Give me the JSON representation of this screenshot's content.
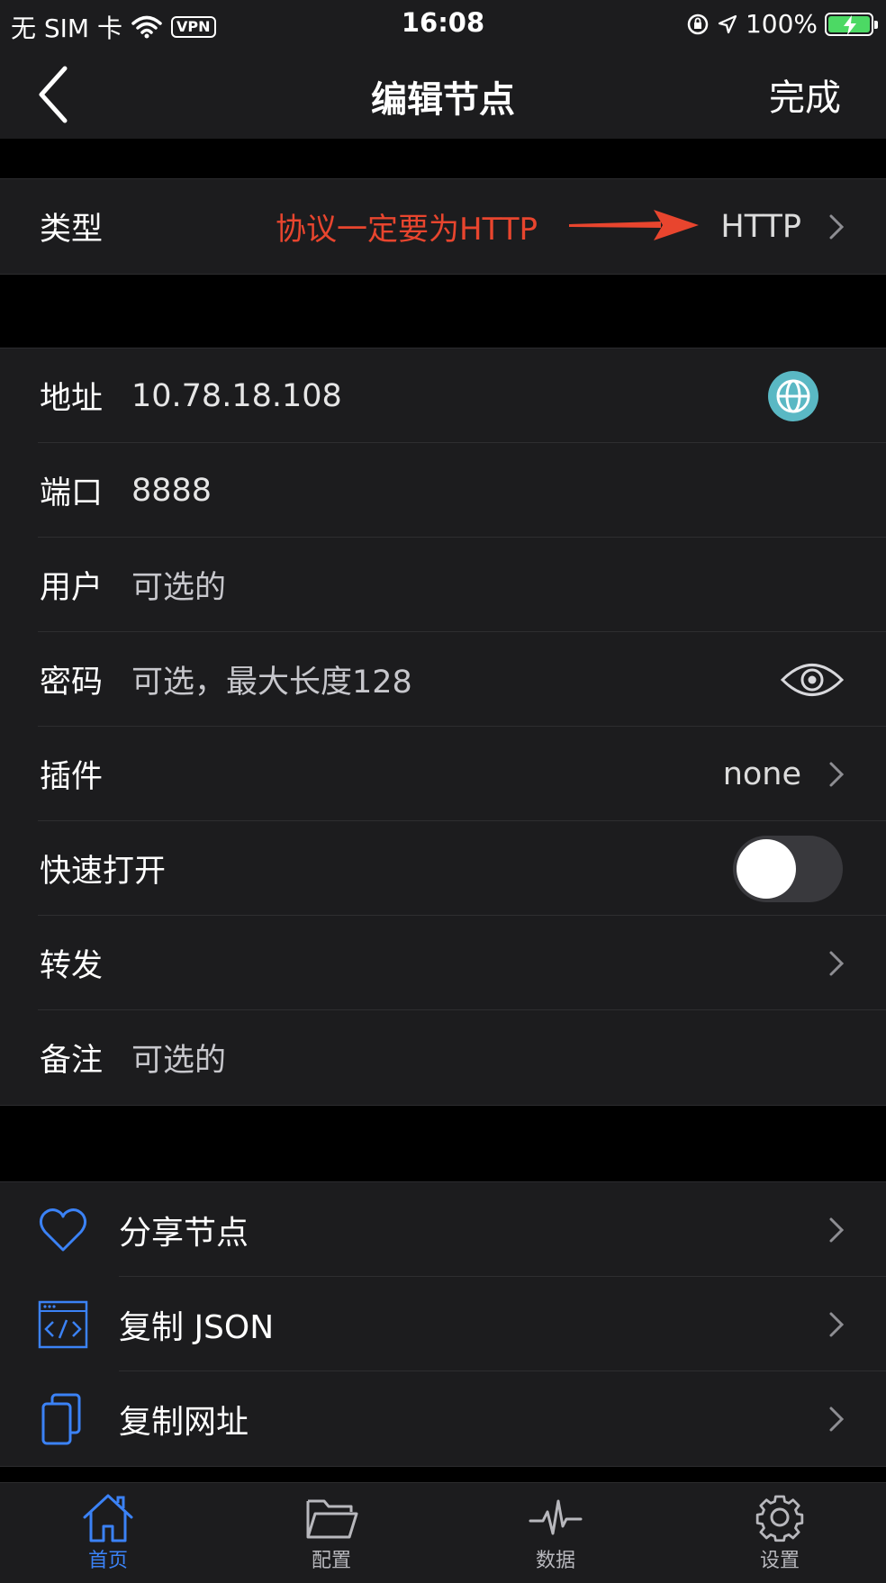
{
  "status_bar": {
    "carrier": "无 SIM 卡",
    "vpn": "VPN",
    "time": "16:08",
    "battery": "100%"
  },
  "nav": {
    "title": "编辑节点",
    "done_label": "完成"
  },
  "type_row": {
    "label": "类型",
    "annotation": "协议一定要为HTTP",
    "value": "HTTP"
  },
  "fields": {
    "address": {
      "label": "地址",
      "value": "10.78.18.108"
    },
    "port": {
      "label": "端口",
      "value": "8888"
    },
    "user": {
      "label": "用户",
      "placeholder": "可选的"
    },
    "password": {
      "label": "密码",
      "placeholder": "可选，最大长度128"
    },
    "plugin": {
      "label": "插件",
      "value": "none"
    },
    "fast_open": {
      "label": "快速打开",
      "enabled": false
    },
    "forward": {
      "label": "转发"
    },
    "note": {
      "label": "备注",
      "placeholder": "可选的"
    }
  },
  "actions": [
    {
      "label": "分享节点",
      "icon": "heart-icon"
    },
    {
      "label": "复制 JSON",
      "icon": "code-window-icon"
    },
    {
      "label": "复制网址",
      "icon": "copy-icon"
    }
  ],
  "tabs": [
    {
      "label": "首页",
      "icon": "home-icon",
      "active": true
    },
    {
      "label": "配置",
      "icon": "folder-icon",
      "active": false
    },
    {
      "label": "数据",
      "icon": "activity-icon",
      "active": false
    },
    {
      "label": "设置",
      "icon": "gear-icon",
      "active": false
    }
  ],
  "colors": {
    "background": "#000000",
    "cell": "#1c1c1e",
    "accent": "#3b82f6",
    "annotation": "#e8452e",
    "globe": "#5ab8c4"
  }
}
